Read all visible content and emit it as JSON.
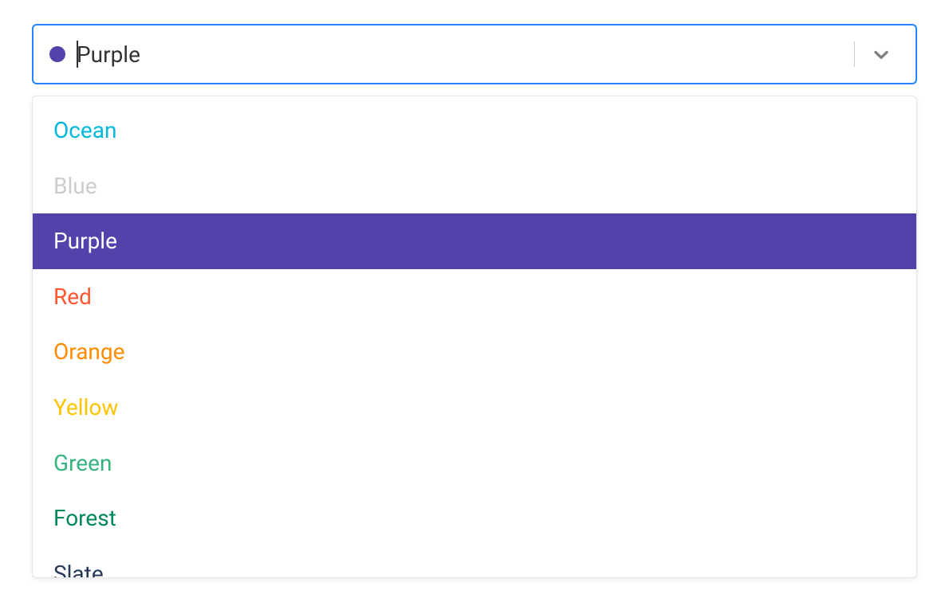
{
  "select": {
    "selected_value": "Purple",
    "selected_color": "#5243AA",
    "options": [
      {
        "label": "Ocean",
        "color": "#00B8D9",
        "selected": false,
        "disabled": false
      },
      {
        "label": "Blue",
        "color": "#0052CC",
        "selected": false,
        "disabled": true
      },
      {
        "label": "Purple",
        "color": "#5243AA",
        "selected": true,
        "disabled": false
      },
      {
        "label": "Red",
        "color": "#FF5630",
        "selected": false,
        "disabled": false
      },
      {
        "label": "Orange",
        "color": "#FF8B00",
        "selected": false,
        "disabled": false
      },
      {
        "label": "Yellow",
        "color": "#FFC400",
        "selected": false,
        "disabled": false
      },
      {
        "label": "Green",
        "color": "#36B37E",
        "selected": false,
        "disabled": false
      },
      {
        "label": "Forest",
        "color": "#00875A",
        "selected": false,
        "disabled": false
      },
      {
        "label": "Slate",
        "color": "#253858",
        "selected": false,
        "disabled": false
      }
    ]
  }
}
